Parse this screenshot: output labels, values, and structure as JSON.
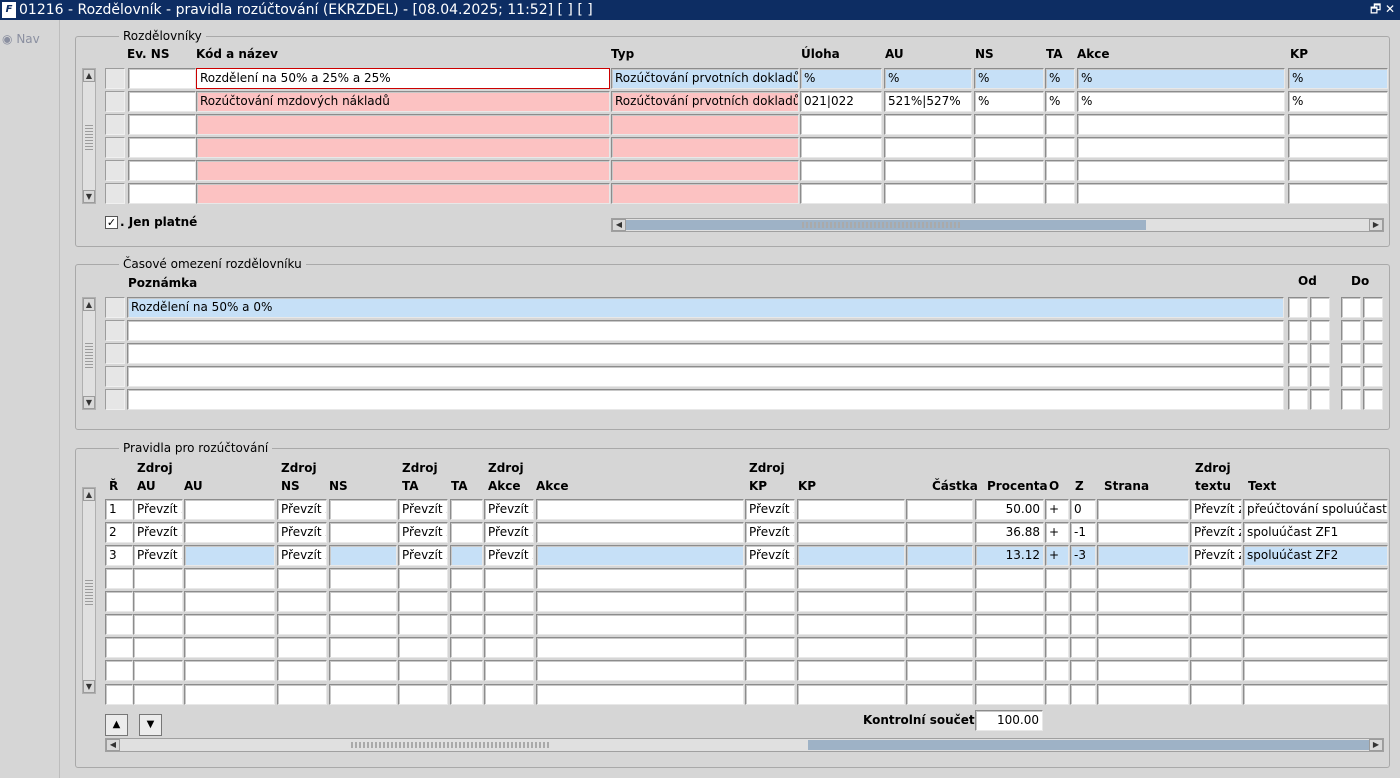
{
  "window": {
    "title": "01216 - Rozdělovník - pravidla rozúčtování (EKRZDEL) - [08.04.2025; 11:52]  [ ]  [ ]",
    "logo": "F",
    "restore_glyph": "🗗",
    "close_glyph": "✕"
  },
  "nav": {
    "label": "Nav"
  },
  "rozdelovniky": {
    "title": "Rozdělovníky",
    "headers": {
      "ev_ns": "Ev. NS",
      "kod": "Kód a název",
      "typ": "Typ",
      "uloha": "Úloha",
      "au": "AU",
      "ns": "NS",
      "ta": "TA",
      "akce": "Akce",
      "kp": "KP"
    },
    "rows": [
      {
        "ev_ns": "",
        "kod": "Rozdělení na 50% a 25% a 25%",
        "typ": "Rozúčtování prvotních dokladů",
        "uloha": "%",
        "au": "%",
        "ns": "%",
        "ta": "%",
        "akce": "%",
        "kp": "%"
      },
      {
        "ev_ns": "",
        "kod": "Rozúčtování mzdových nákladů",
        "typ": "Rozúčtování prvotních dokladů",
        "uloha": "021|022",
        "au": "521%|527%",
        "ns": "%",
        "ta": "%",
        "akce": "%",
        "kp": "%"
      },
      {
        "ev_ns": "",
        "kod": "",
        "typ": "",
        "uloha": "",
        "au": "",
        "ns": "",
        "ta": "",
        "akce": "",
        "kp": ""
      },
      {
        "ev_ns": "",
        "kod": "",
        "typ": "",
        "uloha": "",
        "au": "",
        "ns": "",
        "ta": "",
        "akce": "",
        "kp": ""
      },
      {
        "ev_ns": "",
        "kod": "",
        "typ": "",
        "uloha": "",
        "au": "",
        "ns": "",
        "ta": "",
        "akce": "",
        "kp": ""
      },
      {
        "ev_ns": "",
        "kod": "",
        "typ": "",
        "uloha": "",
        "au": "",
        "ns": "",
        "ta": "",
        "akce": "",
        "kp": ""
      }
    ],
    "jen_platne": {
      "label": "Jen platné",
      "checked": "✓"
    }
  },
  "casove": {
    "title": "Časové omezení rozdělovníku",
    "headers": {
      "poznamka": "Poznámka",
      "od": "Od",
      "do": "Do"
    },
    "rows": [
      {
        "poznamka": "Rozdělení na 50% a 0%"
      },
      {
        "poznamka": ""
      },
      {
        "poznamka": ""
      },
      {
        "poznamka": ""
      },
      {
        "poznamka": ""
      }
    ]
  },
  "pravidla": {
    "title": "Pravidla pro rozúčtování",
    "headers": {
      "r": "Ř",
      "zdroj_au_1": "Zdroj",
      "zdroj_au_2": "AU",
      "au": "AU",
      "zdroj_ns_1": "Zdroj",
      "zdroj_ns_2": "NS",
      "ns": "NS",
      "zdroj_ta_1": "Zdroj",
      "zdroj_ta_2": "TA",
      "ta": "TA",
      "zdroj_akce_1": "Zdroj",
      "zdroj_akce_2": "Akce",
      "akce": "Akce",
      "zdroj_kp_1": "Zdroj",
      "zdroj_kp_2": "KP",
      "kp": "KP",
      "castka": "Částka",
      "procenta": "Procenta",
      "o": "O",
      "z": "Z",
      "strana": "Strana",
      "zdroj_textu_1": "Zdroj",
      "zdroj_textu_2": "textu",
      "text": "Text"
    },
    "rows": [
      {
        "r": "1",
        "zau": "Převzít z",
        "au": "",
        "zns": "Převzít z",
        "ns": "",
        "zta": "Převzít z",
        "ta": "",
        "zakce": "Převzít z",
        "akce": "",
        "zkp": "Převzít z",
        "kp": "",
        "castka": "",
        "procenta": "50.00",
        "o": "+",
        "z": "0",
        "strana": "",
        "ztext": "Převzít z",
        "text": "přeúčtování spoluúčastníků"
      },
      {
        "r": "2",
        "zau": "Převzít z",
        "au": "",
        "zns": "Převzít z",
        "ns": "",
        "zta": "Převzít z",
        "ta": "",
        "zakce": "Převzít z",
        "akce": "",
        "zkp": "Převzít z",
        "kp": "",
        "castka": "",
        "procenta": "36.88",
        "o": "+",
        "z": "-1",
        "strana": "",
        "ztext": "Převzít z",
        "text": "spoluúčast ZF1"
      },
      {
        "r": "3",
        "zau": "Převzít z",
        "au": "",
        "zns": "Převzít z",
        "ns": "",
        "zta": "Převzít z",
        "ta": "",
        "zakce": "Převzít z",
        "akce": "",
        "zkp": "Převzít z",
        "kp": "",
        "castka": "",
        "procenta": "13.12",
        "o": "+",
        "z": "-3",
        "strana": "",
        "ztext": "Převzít z",
        "text": "spoluúčast ZF2"
      },
      {
        "r": "",
        "zau": "",
        "au": "",
        "zns": "",
        "ns": "",
        "zta": "",
        "ta": "",
        "zakce": "",
        "akce": "",
        "zkp": "",
        "kp": "",
        "castka": "",
        "procenta": "",
        "o": "",
        "z": "",
        "strana": "",
        "ztext": "",
        "text": ""
      },
      {
        "r": "",
        "zau": "",
        "au": "",
        "zns": "",
        "ns": "",
        "zta": "",
        "ta": "",
        "zakce": "",
        "akce": "",
        "zkp": "",
        "kp": "",
        "castka": "",
        "procenta": "",
        "o": "",
        "z": "",
        "strana": "",
        "ztext": "",
        "text": ""
      },
      {
        "r": "",
        "zau": "",
        "au": "",
        "zns": "",
        "ns": "",
        "zta": "",
        "ta": "",
        "zakce": "",
        "akce": "",
        "zkp": "",
        "kp": "",
        "castka": "",
        "procenta": "",
        "o": "",
        "z": "",
        "strana": "",
        "ztext": "",
        "text": ""
      },
      {
        "r": "",
        "zau": "",
        "au": "",
        "zns": "",
        "ns": "",
        "zta": "",
        "ta": "",
        "zakce": "",
        "akce": "",
        "zkp": "",
        "kp": "",
        "castka": "",
        "procenta": "",
        "o": "",
        "z": "",
        "strana": "",
        "ztext": "",
        "text": ""
      },
      {
        "r": "",
        "zau": "",
        "au": "",
        "zns": "",
        "ns": "",
        "zta": "",
        "ta": "",
        "zakce": "",
        "akce": "",
        "zkp": "",
        "kp": "",
        "castka": "",
        "procenta": "",
        "o": "",
        "z": "",
        "strana": "",
        "ztext": "",
        "text": ""
      },
      {
        "r": "",
        "zau": "",
        "au": "",
        "zns": "",
        "ns": "",
        "zta": "",
        "ta": "",
        "zakce": "",
        "akce": "",
        "zkp": "",
        "kp": "",
        "castka": "",
        "procenta": "",
        "o": "",
        "z": "",
        "strana": "",
        "ztext": "",
        "text": ""
      }
    ],
    "kontrolni": {
      "label": "Kontrolní součet",
      "value": "100.00"
    },
    "btn_up": "▲",
    "btn_down": "▼"
  },
  "colors": {
    "titlebar": "#0d2d63",
    "selected_row": "#c6e0f7",
    "required_field": "#fcc2c2",
    "scroll_thumb": "#9eb2c6"
  }
}
